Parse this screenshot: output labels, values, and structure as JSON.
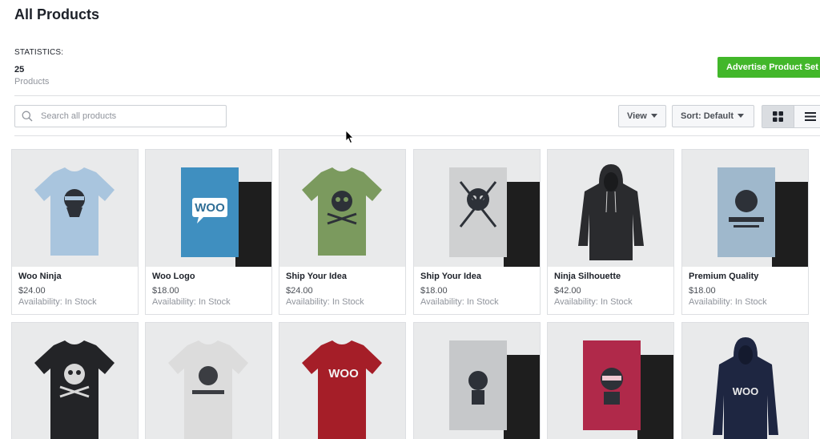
{
  "header": {
    "title": "All Products"
  },
  "statistics": {
    "label": "STATISTICS:",
    "count": "25",
    "unit": "Products"
  },
  "actions": {
    "advertise_label": "Advertise Product Set"
  },
  "toolbar": {
    "search_placeholder": "Search all products",
    "view_label": "View",
    "sort_label": "Sort: Default",
    "layout_selected": "grid"
  },
  "colors": {
    "accent_green": "#42b72a",
    "border": "#dddfe2",
    "muted_text": "#90949c"
  },
  "products": [
    {
      "name": "Woo Ninja",
      "price": "$24.00",
      "availability": "Availability: In Stock",
      "image": "light-blue-tshirt-ninja"
    },
    {
      "name": "Woo Logo",
      "price": "$18.00",
      "availability": "Availability: In Stock",
      "image": "woo-logo-poster"
    },
    {
      "name": "Ship Your Idea",
      "price": "$24.00",
      "availability": "Availability: In Stock",
      "image": "green-tshirt-skull"
    },
    {
      "name": "Ship Your Idea",
      "price": "$18.00",
      "availability": "Availability: In Stock",
      "image": "skull-poster"
    },
    {
      "name": "Ninja Silhouette",
      "price": "$42.00",
      "availability": "Availability: In Stock",
      "image": "black-hoodie"
    },
    {
      "name": "Premium Quality",
      "price": "$18.00",
      "availability": "Availability: In Stock",
      "image": "woothemes-poster"
    },
    {
      "name": "",
      "price": "",
      "availability": "",
      "image": "black-tshirt-skull"
    },
    {
      "name": "",
      "price": "",
      "availability": "",
      "image": "white-tshirt-woothemes"
    },
    {
      "name": "",
      "price": "",
      "availability": "",
      "image": "red-tshirt-woo"
    },
    {
      "name": "",
      "price": "",
      "availability": "",
      "image": "ninja-poster"
    },
    {
      "name": "",
      "price": "",
      "availability": "",
      "image": "red-ninja-poster"
    },
    {
      "name": "",
      "price": "",
      "availability": "",
      "image": "navy-hoodie-woo"
    }
  ]
}
